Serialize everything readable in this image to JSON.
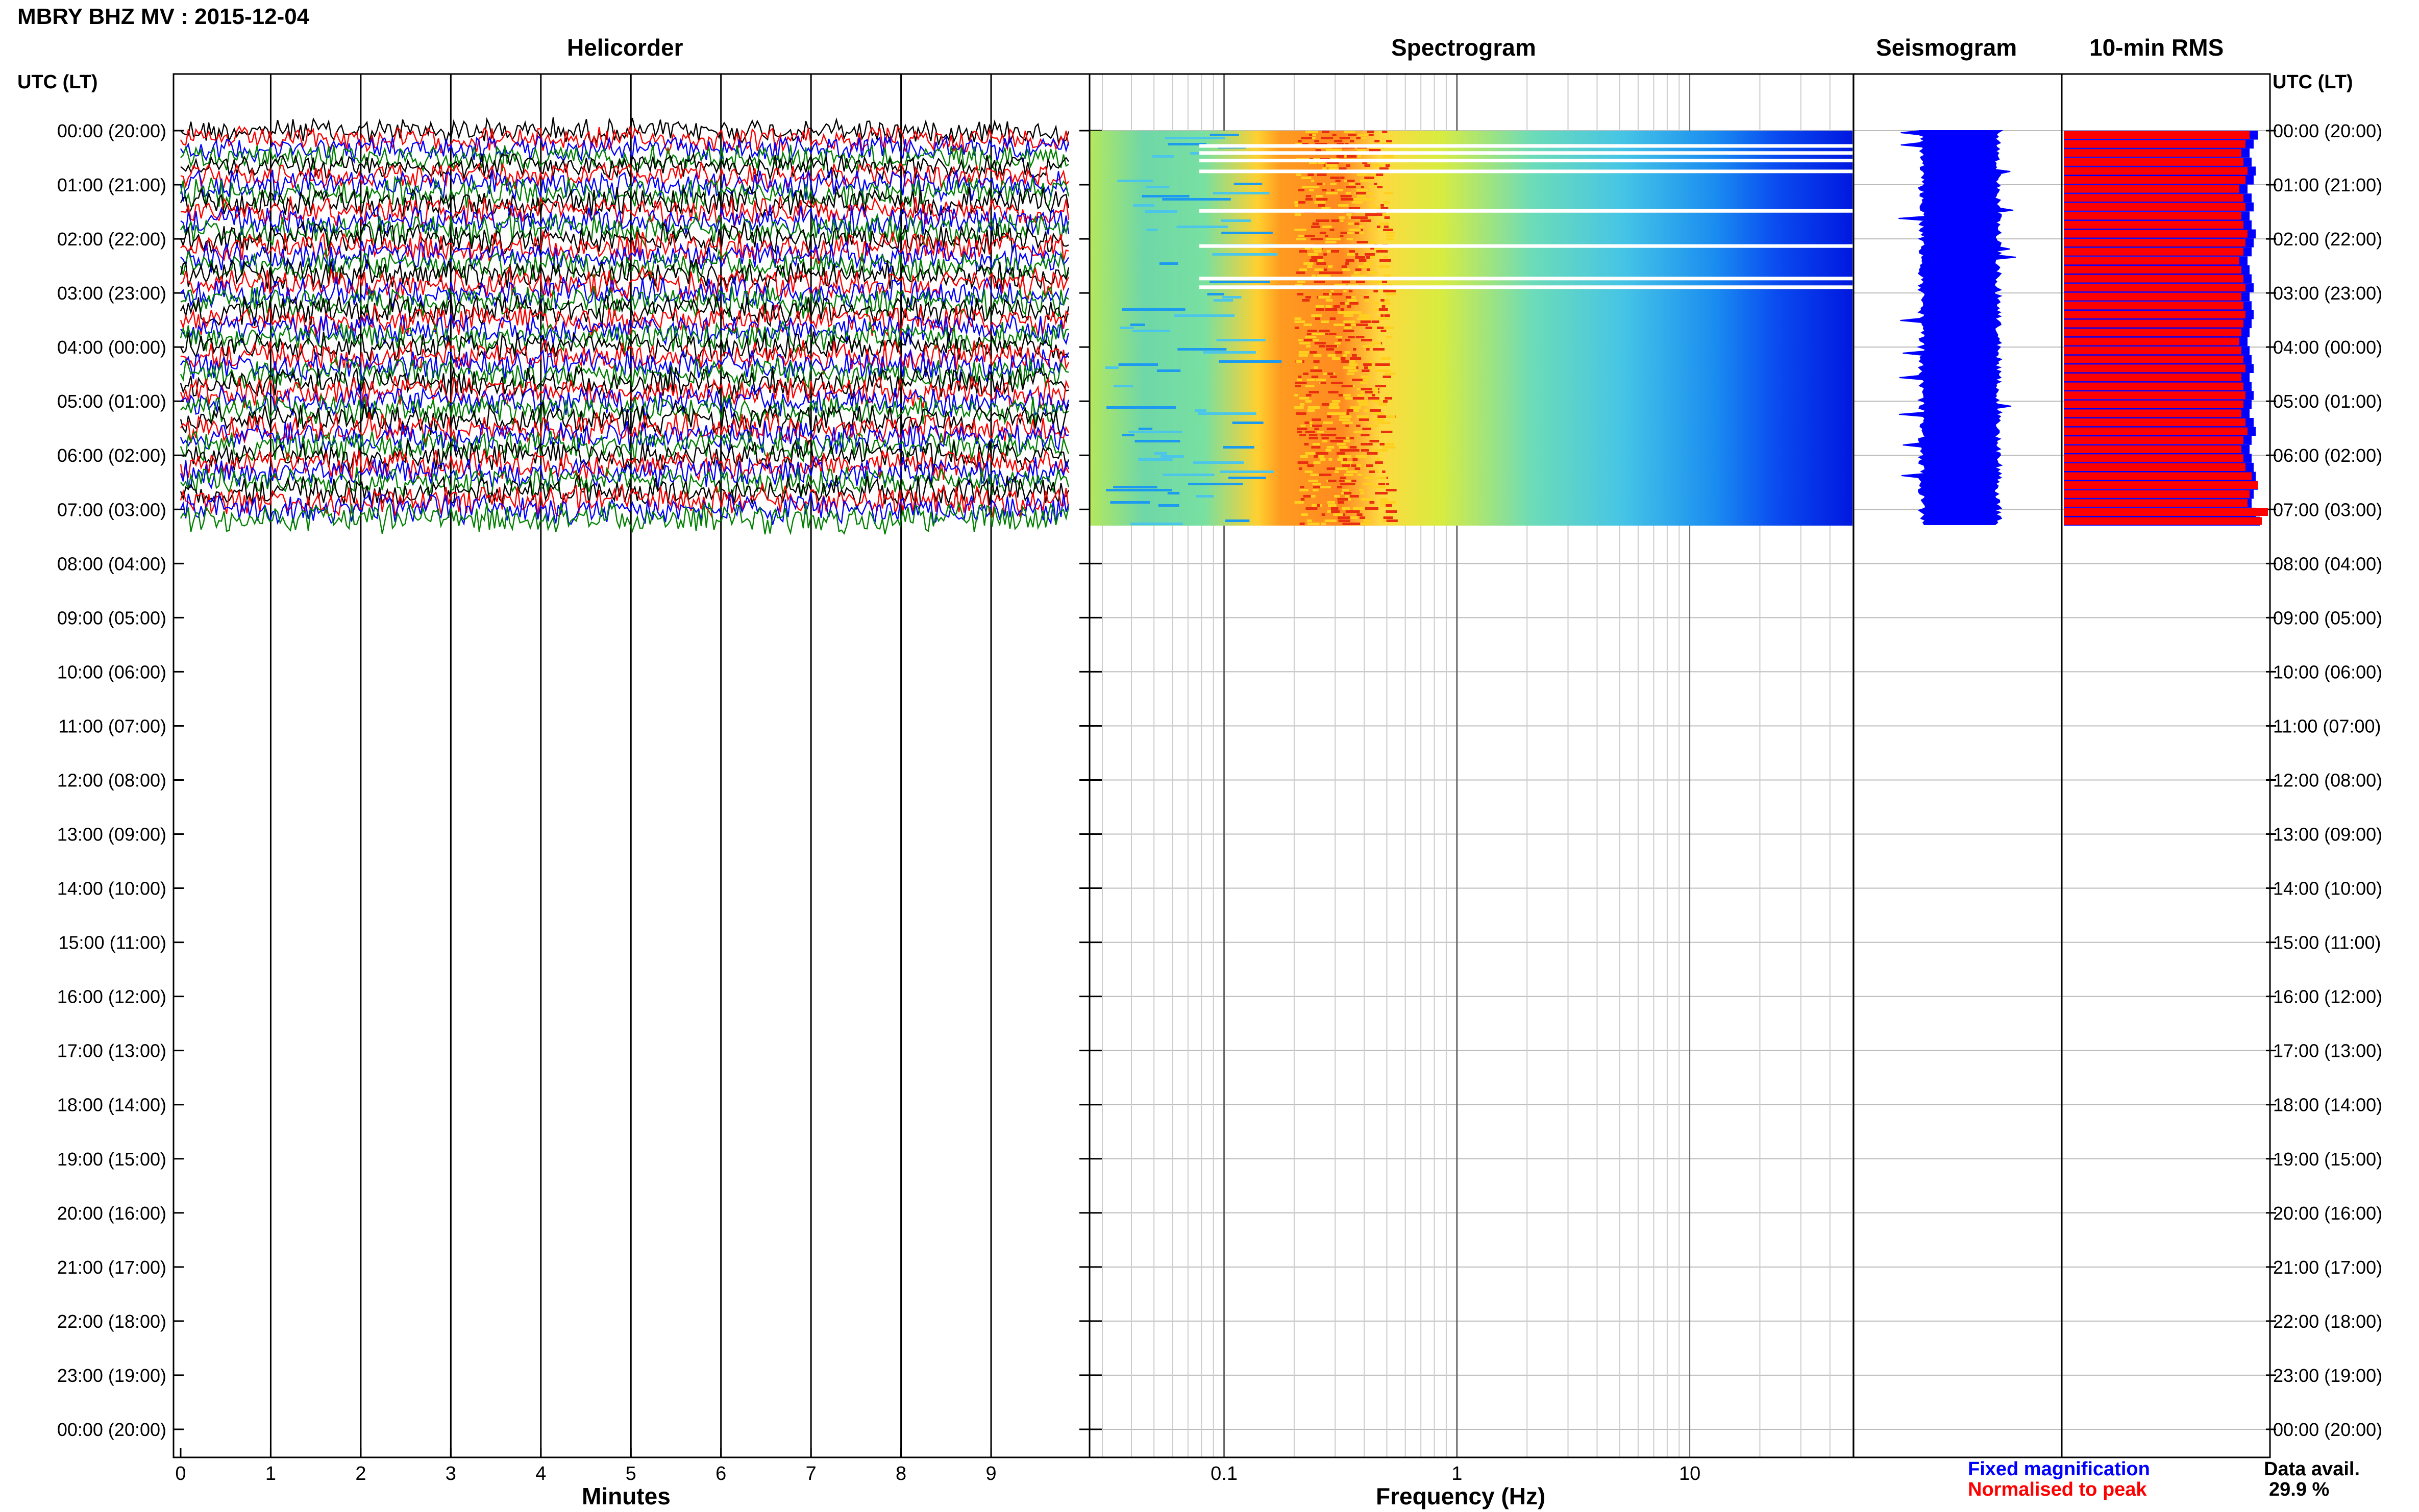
{
  "figure_title": "MBRY BHZ MV : 2015-12-04",
  "utc_header_left": "UTC (LT)",
  "utc_header_right": "UTC (LT)",
  "panels": {
    "helicorder": "Helicorder",
    "spectrogram": "Spectrogram",
    "seismogram": "Seismogram",
    "rms": "10-min RMS"
  },
  "x_labels": {
    "helicorder": "Minutes",
    "spectrogram": "Frequency (Hz)"
  },
  "legend": {
    "fixed": "Fixed magnification",
    "normalised": "Normalised to peak",
    "fixed_color": "#0000ff",
    "normalised_color": "#ff0000"
  },
  "data_availability": {
    "label": "Data avail.",
    "value": "29.9 %"
  },
  "colors": {
    "trace_cycle": [
      "#000000",
      "#ff0000",
      "#0000ff",
      "#008000"
    ],
    "seismogram": "#0000ff",
    "rms_normalised": "#ff0000",
    "rms_fixed": "#0000ff"
  },
  "chart_data": [
    {
      "type": "line",
      "title": "Helicorder",
      "xlabel": "Minutes",
      "x_ticks": [
        0,
        1,
        2,
        3,
        4,
        5,
        6,
        7,
        8,
        9
      ],
      "xlim": [
        0,
        10
      ],
      "time_labels": [
        "00:00 (20:00)",
        "01:00 (21:00)",
        "02:00 (22:00)",
        "03:00 (23:00)",
        "04:00 (00:00)",
        "05:00 (01:00)",
        "06:00 (02:00)",
        "07:00 (03:00)",
        "08:00 (04:00)",
        "09:00 (05:00)",
        "10:00 (06:00)",
        "11:00 (07:00)",
        "12:00 (08:00)",
        "13:00 (09:00)",
        "14:00 (10:00)",
        "15:00 (11:00)",
        "16:00 (12:00)",
        "17:00 (13:00)",
        "18:00 (14:00)",
        "19:00 (15:00)",
        "20:00 (16:00)",
        "21:00 (17:00)",
        "22:00 (18:00)",
        "23:00 (19:00)",
        "00:00 (20:00)"
      ],
      "traces_per_hour": 6,
      "data_hours": 7.3
    },
    {
      "type": "heatmap",
      "title": "Spectrogram",
      "xlabel": "Frequency (Hz)",
      "x_scale": "log",
      "x_ticks": [
        "0.1",
        "1",
        "10"
      ],
      "xlim": [
        0.03,
        50
      ],
      "peak_band_hz": [
        0.2,
        0.5
      ],
      "data_hours": 7.3
    },
    {
      "type": "line",
      "title": "Seismogram",
      "data_hours": 7.3
    },
    {
      "type": "bar",
      "title": "10-min RMS",
      "series": [
        {
          "name": "Fixed magnification",
          "color": "#0000ff",
          "values": [
            0.95,
            0.93,
            0.91,
            0.92,
            0.94,
            0.93,
            0.9,
            0.92,
            0.93,
            0.91,
            0.92,
            0.94,
            0.93,
            0.92,
            0.9,
            0.91,
            0.92,
            0.93,
            0.91,
            0.92,
            0.93,
            0.92,
            0.91,
            0.9,
            0.91,
            0.92,
            0.93,
            0.91,
            0.92,
            0.93,
            0.92,
            0.91,
            0.93,
            0.94,
            0.92,
            0.91,
            0.92,
            0.93,
            0.94,
            0.95,
            0.93,
            0.92,
            0.94,
            0.96
          ]
        },
        {
          "name": "Normalised to peak",
          "color": "#ff0000",
          "values": [
            0.91,
            0.89,
            0.87,
            0.88,
            0.9,
            0.89,
            0.86,
            0.88,
            0.89,
            0.87,
            0.88,
            0.9,
            0.89,
            0.88,
            0.86,
            0.87,
            0.88,
            0.89,
            0.87,
            0.88,
            0.89,
            0.88,
            0.87,
            0.86,
            0.87,
            0.88,
            0.89,
            0.87,
            0.88,
            0.89,
            0.88,
            0.87,
            0.89,
            0.9,
            0.88,
            0.87,
            0.88,
            0.89,
            0.92,
            0.95,
            0.91,
            0.9,
            1.0,
            0.97
          ]
        }
      ],
      "data_hours": 7.3
    }
  ]
}
